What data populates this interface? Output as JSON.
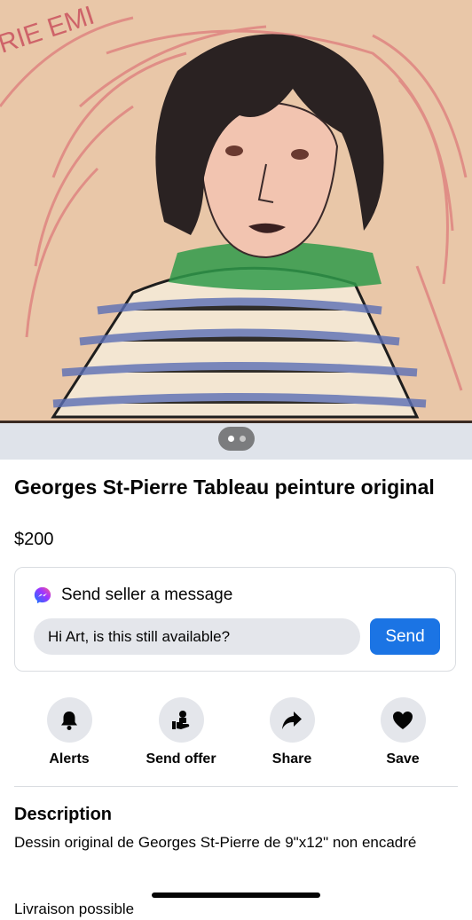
{
  "photo": {
    "image_label": "crayon drawing of a woman with dark bob hair and striped sweater",
    "page_indicator": {
      "count": 2,
      "active": 1
    }
  },
  "listing": {
    "title": "Georges St-Pierre Tableau peinture original",
    "price": "$200"
  },
  "message": {
    "heading": "Send seller a message",
    "input_value": "Hi Art, is this still available?",
    "send_label": "Send",
    "send_color": "#1b74e4"
  },
  "actions": [
    {
      "label": "Alerts",
      "icon": "bell-icon"
    },
    {
      "label": "Send offer",
      "icon": "offer-icon"
    },
    {
      "label": "Share",
      "icon": "share-icon"
    },
    {
      "label": "Save",
      "icon": "heart-icon"
    }
  ],
  "description": {
    "heading": "Description",
    "text": "Dessin original de Georges St-Pierre de 9\"x12\" non encadré",
    "partial_next_line": "Livraison possible"
  }
}
